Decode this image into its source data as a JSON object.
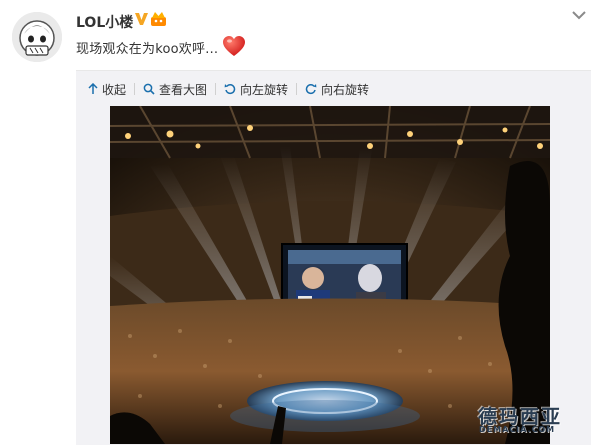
{
  "user": {
    "name": "LOL小楼",
    "colors": {
      "vip": "#f5a623",
      "crown": "#ff8a00"
    }
  },
  "post": {
    "text": "现场观众在为koo欢呼…",
    "emoji": "red-heart-emoji"
  },
  "toolbar": {
    "collapse_label": "收起",
    "view_large_label": "查看大图",
    "rotate_left_label": "向左旋转",
    "rotate_right_label": "向右旋转",
    "icon_color": "#1a6fad"
  },
  "watermark": {
    "text": "德玛西亚",
    "sub": "DEMACIA.COM"
  }
}
